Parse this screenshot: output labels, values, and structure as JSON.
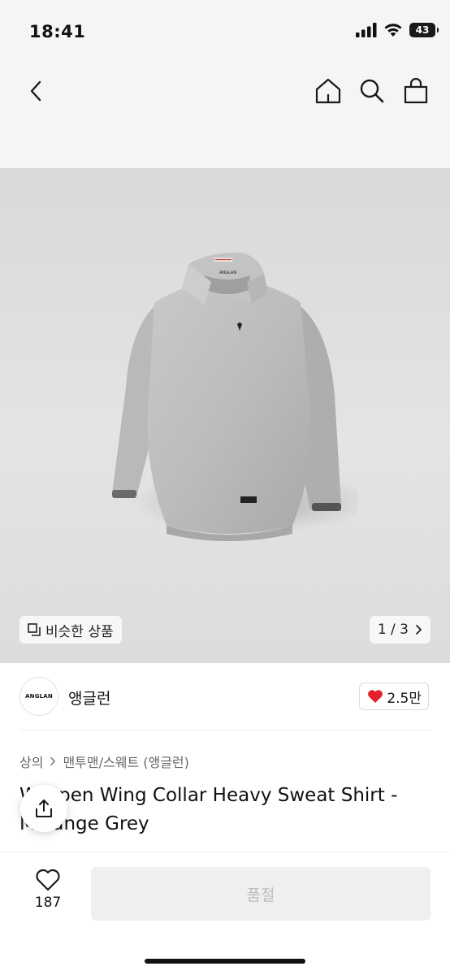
{
  "status_bar": {
    "time": "18:41",
    "battery": "43"
  },
  "icons": {
    "back": "chevron-left-icon",
    "home": "home-icon",
    "search": "search-icon",
    "cart": "shopping-bag-icon",
    "similar": "similar-items-icon",
    "page_next": "chevron-right-icon",
    "like": "heart-filled-icon",
    "share": "share-icon",
    "wishlist": "heart-outline-icon"
  },
  "gallery": {
    "similar_label": "비슷한 상품",
    "page_indicator": "1 / 3",
    "product_label_text": "ANGLAN"
  },
  "brand": {
    "logo_text": "ANGLAN",
    "name": "앵글런",
    "likes": "2.5만"
  },
  "breadcrumb": {
    "category": "상의",
    "subcategory": "맨투맨/스웨트 (앵글런)"
  },
  "product": {
    "title": "W Open Wing Collar Heavy Sweat Shirt - Melange Grey"
  },
  "bottom_bar": {
    "wish_count": "187",
    "buy_label": "품절"
  },
  "colors": {
    "accent_heart": "#e4202b",
    "disabled_bg": "#efefef",
    "disabled_text": "#bdbdbd"
  }
}
